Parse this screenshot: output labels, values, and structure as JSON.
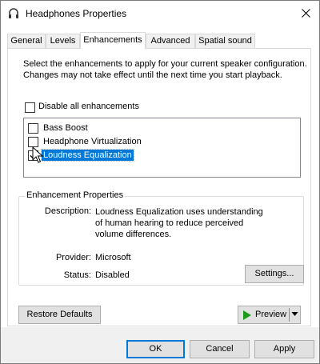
{
  "window": {
    "title": "Headphones Properties",
    "icon": "headphones-icon",
    "close_icon": "close-icon"
  },
  "tabs": [
    {
      "label": "General",
      "active": false
    },
    {
      "label": "Levels",
      "active": false
    },
    {
      "label": "Enhancements",
      "active": true
    },
    {
      "label": "Advanced",
      "active": false
    },
    {
      "label": "Spatial sound",
      "active": false
    }
  ],
  "enhancements": {
    "description": "Select the enhancements to apply for your current speaker configuration. Changes may not take effect until the next time you start playback.",
    "disable_all_label": "Disable all enhancements",
    "disable_all_checked": false,
    "items": [
      {
        "label": "Bass Boost",
        "checked": false,
        "selected": false
      },
      {
        "label": "Headphone Virtualization",
        "checked": false,
        "selected": false
      },
      {
        "label": "Loudness Equalization",
        "checked": true,
        "selected": true
      }
    ]
  },
  "properties": {
    "group_title": "Enhancement Properties",
    "description_label": "Description:",
    "description_value": "Loudness Equalization uses understanding of human hearing to reduce perceived volume differences.",
    "provider_label": "Provider:",
    "provider_value": "Microsoft",
    "status_label": "Status:",
    "status_value": "Disabled",
    "settings_button": "Settings..."
  },
  "actions": {
    "restore_defaults": "Restore Defaults",
    "preview": "Preview",
    "ok": "OK",
    "cancel": "Cancel",
    "apply": "Apply"
  },
  "colors": {
    "selection": "#0078d7",
    "play_icon": "#1a9c1a",
    "focus_border": "#0078d7"
  }
}
